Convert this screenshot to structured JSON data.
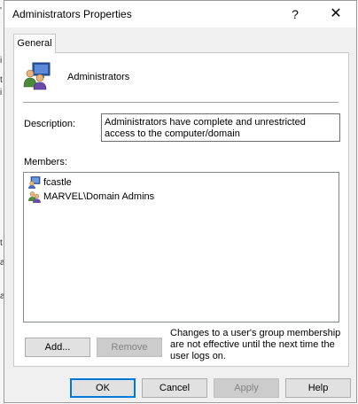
{
  "window": {
    "title": "Administrators Properties",
    "help_label": "?",
    "close_label": "✕"
  },
  "tabs": [
    {
      "label": "General",
      "active": true
    }
  ],
  "group": {
    "name": "Administrators",
    "icon": "group-icon"
  },
  "description": {
    "label": "Description:",
    "value": "Administrators have complete and unrestricted access to the computer/domain"
  },
  "members": {
    "label": "Members:",
    "items": [
      {
        "name": "fcastle",
        "icon": "user-icon"
      },
      {
        "name": "MARVEL\\Domain Admins",
        "icon": "group-icon"
      }
    ]
  },
  "buttons": {
    "add": "Add...",
    "remove": "Remove",
    "ok": "OK",
    "cancel": "Cancel",
    "apply": "Apply",
    "help": "Help"
  },
  "note": "Changes to a user's group membership are not effective until the next time the user logs on.",
  "colors": {
    "accent": "#0078d7",
    "window_bg": "#f0f0f0",
    "panel_bg": "#ffffff"
  }
}
